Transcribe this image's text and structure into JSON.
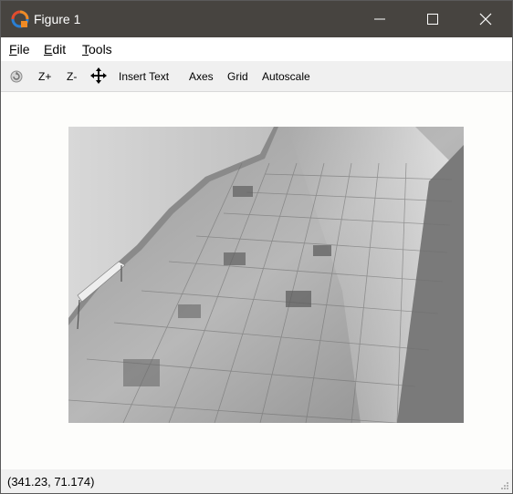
{
  "window": {
    "title": "Figure 1",
    "accent_color": "#474440",
    "icons": {
      "app": "app-logo-icon",
      "minimize": "minimize-icon",
      "maximize": "maximize-icon",
      "close": "close-icon"
    }
  },
  "menu": {
    "file": {
      "accel": "F",
      "rest": "ile"
    },
    "edit": {
      "accel": "E",
      "rest": "dit"
    },
    "tools": {
      "accel": "T",
      "rest": "ools"
    }
  },
  "toolbar": {
    "home_icon": "home-icon",
    "zoom_in": "Z+",
    "zoom_out": "Z-",
    "move_icon": "move-arrows-icon",
    "insert_text": "Insert Text",
    "axes": "Axes",
    "grid": "Grid",
    "autoscale": "Autoscale"
  },
  "figure": {
    "content": "grayscale photo of a tiled floor beside a white wall with a bench"
  },
  "status": {
    "coordinates": "(341.23, 71.174)"
  }
}
